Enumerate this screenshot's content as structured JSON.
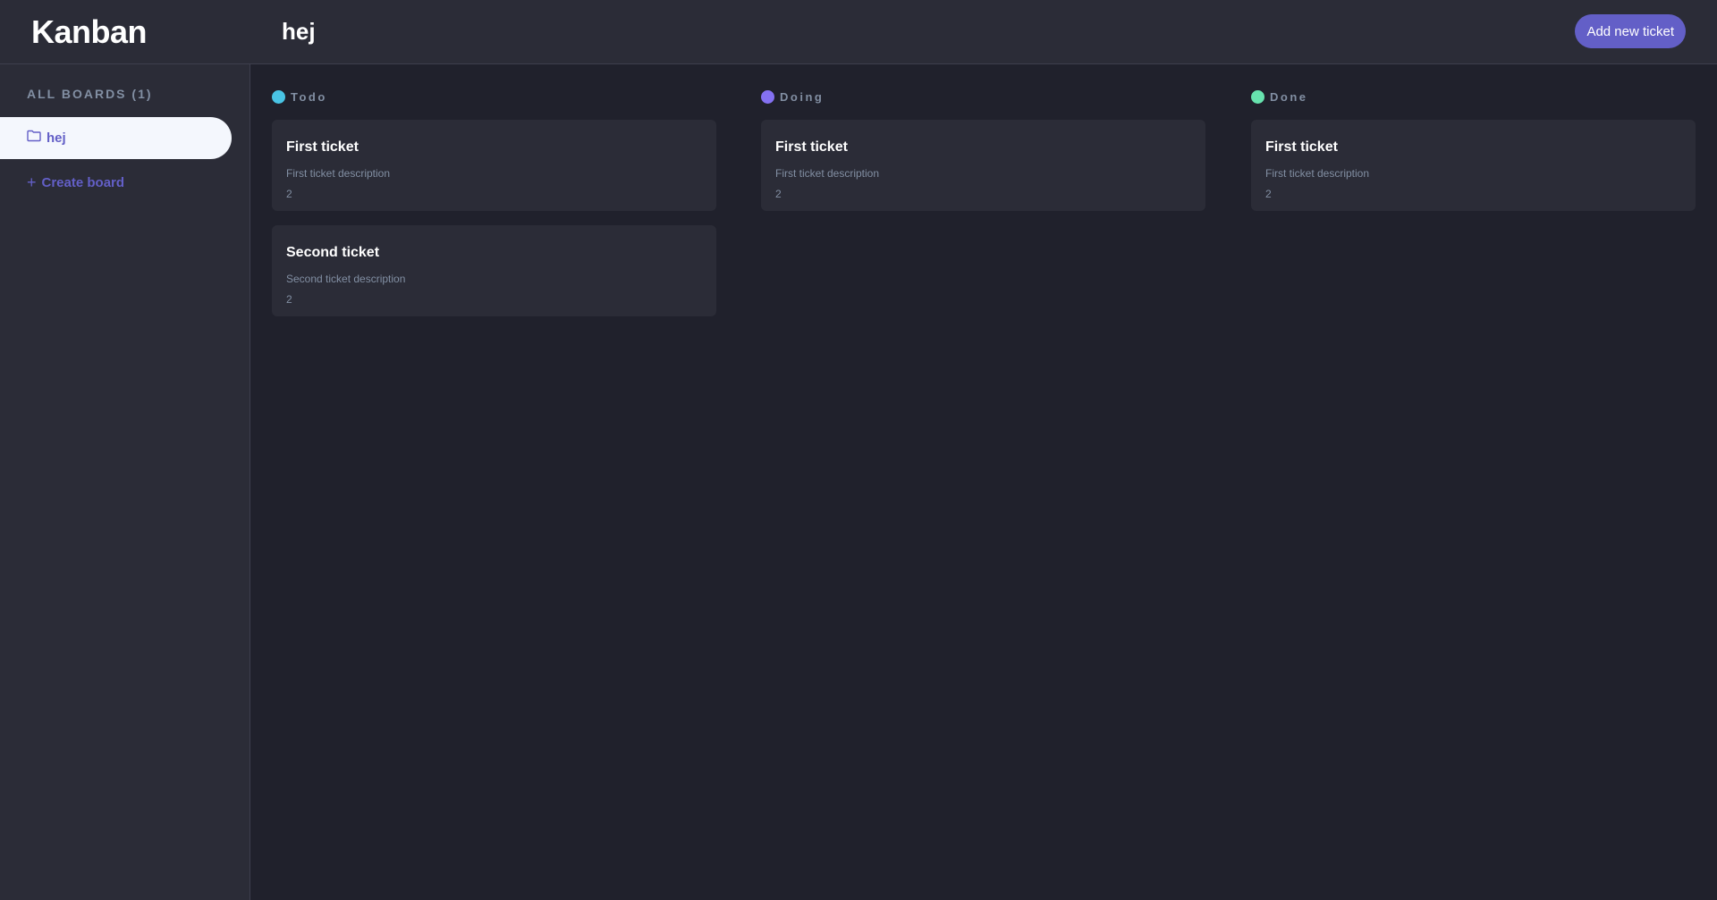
{
  "app": {
    "logo": "Kanban"
  },
  "header": {
    "board_title": "hej",
    "add_ticket_label": "Add new ticket"
  },
  "sidebar": {
    "heading": "ALL BOARDS (1)",
    "boards": [
      {
        "label": "hej",
        "icon": "folder-icon"
      }
    ],
    "create_label": "Create board"
  },
  "colors": {
    "accent": "#635fc7",
    "todo": "#49c4e5",
    "doing": "#8471f2",
    "done": "#67e2ae"
  },
  "columns": [
    {
      "name": "Todo",
      "tickets": [
        {
          "title": "First ticket",
          "description": "First ticket description",
          "count": "2"
        },
        {
          "title": "Second ticket",
          "description": "Second ticket description",
          "count": "2"
        }
      ]
    },
    {
      "name": "Doing",
      "tickets": [
        {
          "title": "First ticket",
          "description": "First ticket description",
          "count": "2"
        }
      ]
    },
    {
      "name": "Done",
      "tickets": [
        {
          "title": "First ticket",
          "description": "First ticket description",
          "count": "2"
        }
      ]
    }
  ]
}
